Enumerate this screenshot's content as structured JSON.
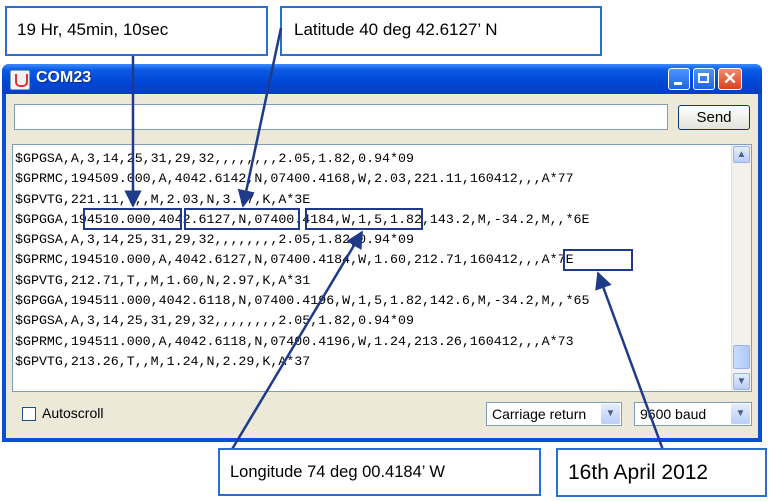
{
  "window": {
    "title": "COM23",
    "send_label": "Send",
    "command_value": "",
    "serial_lines": [
      "$GPGSA,A,3,14,25,31,29,32,,,,,,,,2.05,1.82,0.94*09",
      "$GPRMC,194509.000,A,4042.6142,N,07400.4168,W,2.03,221.11,160412,,,A*77",
      "$GPVTG,221.11,T,,M,2.03,N,3.77,K,A*3E",
      "$GPGGA,194510.000,4042.6127,N,07400.4184,W,1,5,1.82,143.2,M,-34.2,M,,*6E",
      "$GPGSA,A,3,14,25,31,29,32,,,,,,,,2.05,1.82,0.94*09",
      "$GPRMC,194510.000,A,4042.6127,N,07400.4184,W,1.60,212.71,160412,,,A*7E",
      "$GPVTG,212.71,T,,M,1.60,N,2.97,K,A*31",
      "$GPGGA,194511.000,4042.6118,N,07400.4196,W,1,5,1.82,142.6,M,-34.2,M,,*65",
      "$GPGSA,A,3,14,25,31,29,32,,,,,,,,2.05,1.82,0.94*09",
      "$GPRMC,194511.000,A,4042.6118,N,07400.4196,W,1.24,213.26,160412,,,A*73",
      "$GPVTG,213.26,T,,M,1.24,N,2.29,K,A*37"
    ],
    "autoscroll_label": "Autoscroll",
    "autoscroll_checked": false,
    "line_ending": "Carriage return",
    "baud_rate": "9600 baud"
  },
  "annotations": {
    "time": "19 Hr, 45min, 10sec",
    "latitude": "Latitude 40 deg 42.6127’ N",
    "longitude": "Longitude 74 deg 00.4184’ W",
    "date": "16th April 2012"
  },
  "colors": {
    "callout_border": "#2a6ed0",
    "highlight_border": "#1e3a88",
    "arrow": "#1e3a88",
    "titlebar": "#0047d6"
  }
}
